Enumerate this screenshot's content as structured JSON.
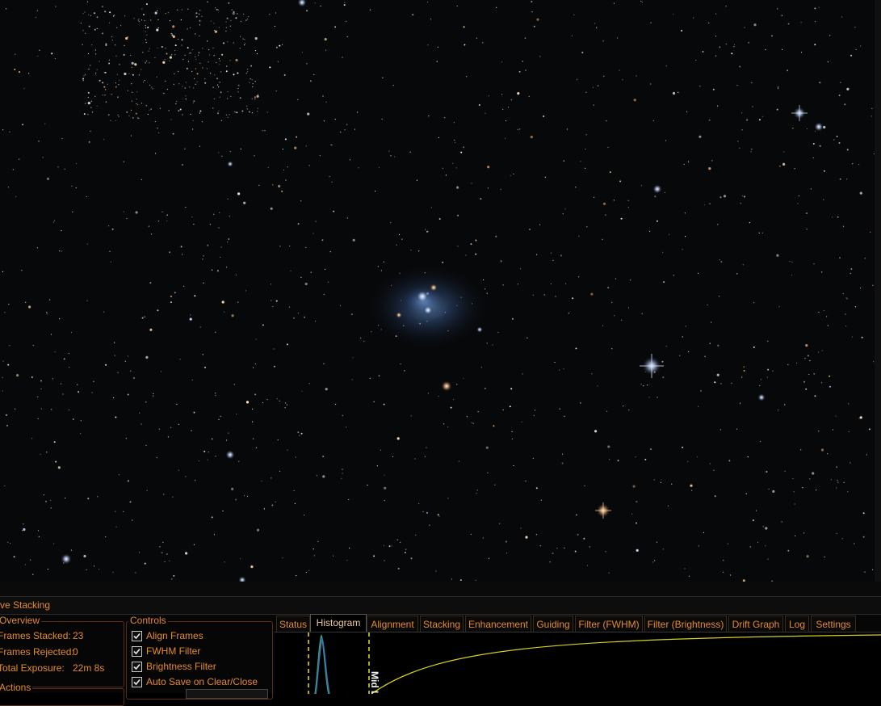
{
  "panel": {
    "title": "ve Stacking"
  },
  "overview": {
    "title": "Overview",
    "frames_stacked_label": "Frames Stacked:",
    "frames_stacked_value": "23",
    "frames_rejected_label": "Frames Rejected:",
    "frames_rejected_value": "0",
    "total_exposure_label": "Total Exposure:",
    "total_exposure_value": "22m 8s"
  },
  "actions": {
    "title": "Actions"
  },
  "controls": {
    "title": "Controls",
    "items": [
      {
        "label": "Align Frames",
        "checked": true
      },
      {
        "label": "FWHM Filter",
        "checked": true
      },
      {
        "label": "Brightness Filter",
        "checked": true
      },
      {
        "label": "Auto Save on Clear/Close",
        "checked": true
      }
    ]
  },
  "tabs": [
    {
      "label": "Status",
      "active": false
    },
    {
      "label": "Histogram",
      "active": true
    },
    {
      "label": "Alignment",
      "active": false
    },
    {
      "label": "Stacking",
      "active": false
    },
    {
      "label": "Enhancement",
      "active": false
    },
    {
      "label": "Guiding",
      "active": false
    },
    {
      "label": "Filter (FWHM)",
      "active": false
    },
    {
      "label": "Filter (Brightness)",
      "active": false
    },
    {
      "label": "Drift Graph",
      "active": false
    },
    {
      "label": "Log",
      "active": false
    },
    {
      "label": "Settings",
      "active": false
    }
  ],
  "histogram": {
    "mid_label": "Mid L"
  },
  "colors": {
    "accent": "#e58a2c",
    "curve": "#d8d020",
    "marker": "#f0e020",
    "histogram_blue": "#3a70c0",
    "histogram_green": "#40a060"
  }
}
